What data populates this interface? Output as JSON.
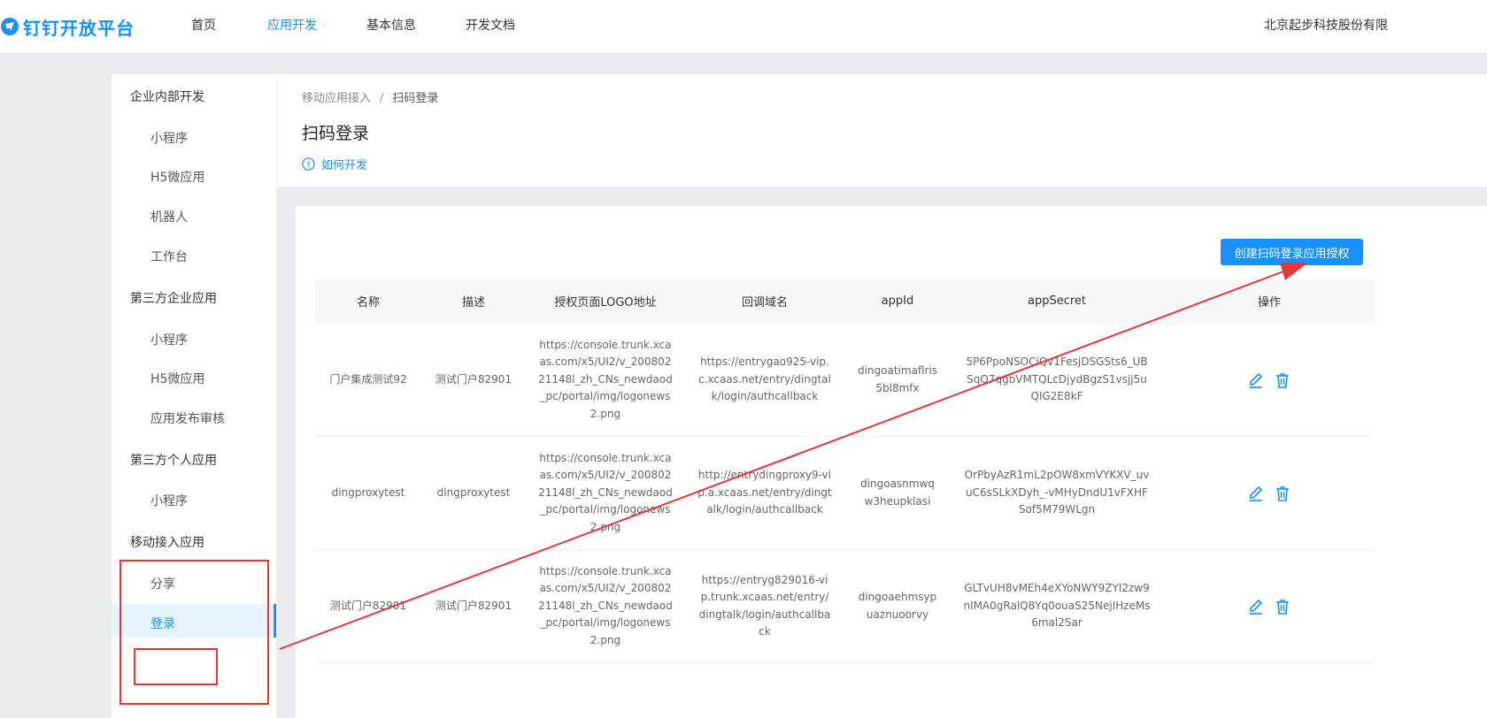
{
  "header": {
    "logo_text": "钉钉开放平台",
    "nav": [
      {
        "label": "首页",
        "active": false
      },
      {
        "label": "应用开发",
        "active": true
      },
      {
        "label": "基本信息",
        "active": false
      },
      {
        "label": "开发文档",
        "active": false
      }
    ],
    "company": "北京起步科技股份有限"
  },
  "sidebar": {
    "groups": [
      {
        "title": "企业内部开发",
        "items": [
          "小程序",
          "H5微应用",
          "机器人",
          "工作台"
        ]
      },
      {
        "title": "第三方企业应用",
        "items": [
          "小程序",
          "H5微应用",
          "应用发布审核"
        ]
      },
      {
        "title": "第三方个人应用",
        "items": [
          "小程序"
        ]
      },
      {
        "title": "移动接入应用",
        "items": [
          "分享",
          "登录"
        ]
      }
    ],
    "active_item": "登录"
  },
  "breadcrumb": {
    "parent": "移动应用接入",
    "separator": "/",
    "current": "扫码登录"
  },
  "page_title": "扫码登录",
  "howto_link": "如何开发",
  "create_button": "创建扫码登录应用授权",
  "table": {
    "columns": [
      "名称",
      "描述",
      "授权页面LOGO地址",
      "回调域名",
      "appId",
      "appSecret",
      "操作"
    ],
    "rows": [
      {
        "name": "门户集成测试92",
        "desc": "测试门户82901",
        "logo": "https://console.trunk.xcaas.com/x5/UI2/v_20080221148l_zh_CNs_newdaod_pc/portal/img/logonews2.png",
        "callback": "https://entrygao925-vip.c.xcaas.net/entry/dingtalk/login/authcallback",
        "appid": "dingoatimaflris5bl8mfx",
        "secret": "5P6PpoNSOCiQv1FesjDSGSts6_UBSqO7qgbVMTQLcDjydBgzS1vsjj5uQIG2E8kF"
      },
      {
        "name": "dingproxytest",
        "desc": "dingproxytest",
        "logo": "https://console.trunk.xcaas.com/x5/UI2/v_20080221148l_zh_CNs_newdaod_pc/portal/img/logonews2.png",
        "callback": "http://entrydingproxy9-vip.a.xcaas.net/entry/dingtalk/login/authcallback",
        "appid": "dingoasnmwqw3heupklasi",
        "secret": "OrPbyAzR1mL2pOW8xmVYKXV_uvuC6sSLkXDyh_-vMHyDndU1vFXHFSof5M79WLgn"
      },
      {
        "name": "测试门户82901",
        "desc": "测试门户82901",
        "logo": "https://console.trunk.xcaas.com/x5/UI2/v_20080221148l_zh_CNs_newdaod_pc/portal/img/logonews2.png",
        "callback": "https://entryg829016-vip.trunk.xcaas.net/entry/dingtalk/login/authcallback",
        "appid": "dingoaehmsypuaznuoorvy",
        "secret": "GLTvUH8vMEh4eXYoNWY9ZYI2zw9nIMA0gRalQ8Yq0ouaS25NejIHzeMs6mal2Sar"
      }
    ]
  },
  "colors": {
    "accent": "#1890ff",
    "annotation": "#e03a3a"
  }
}
